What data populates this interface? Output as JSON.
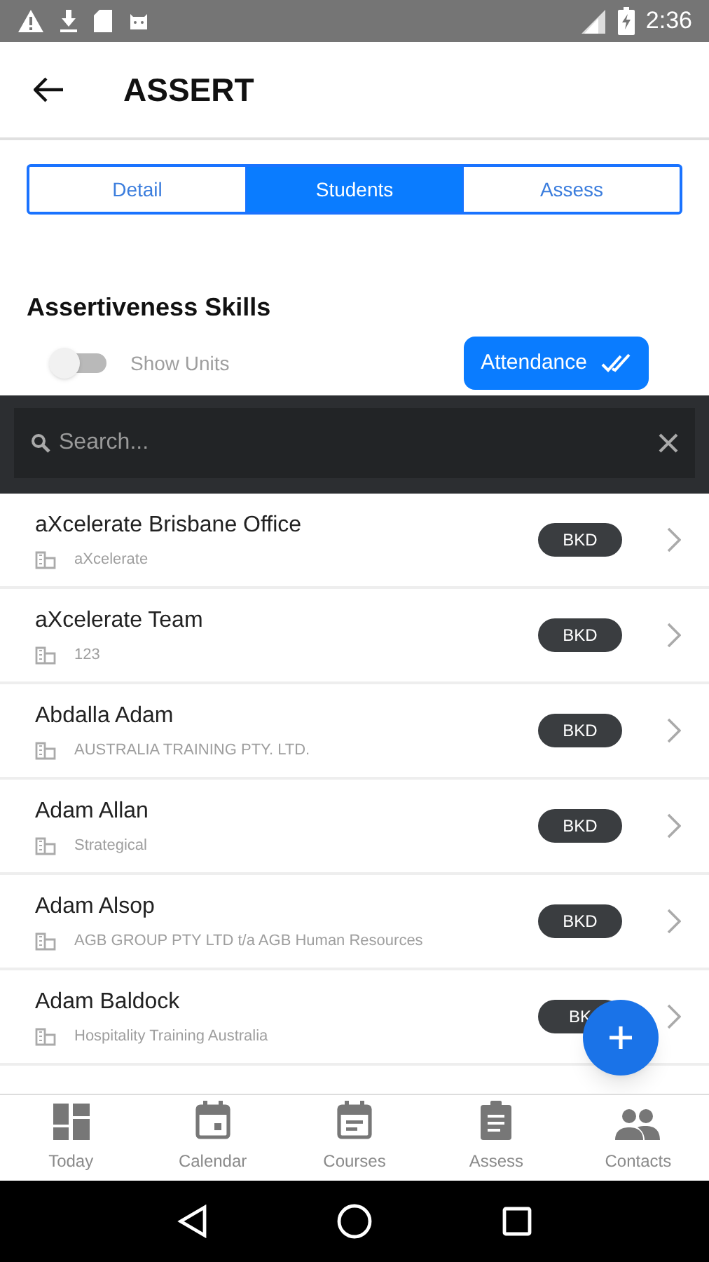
{
  "status_bar": {
    "time": "2:36"
  },
  "app_bar": {
    "title": "ASSERT"
  },
  "tabs": [
    {
      "label": "Detail",
      "selected": false
    },
    {
      "label": "Students",
      "selected": true
    },
    {
      "label": "Assess",
      "selected": false
    }
  ],
  "course_title": "Assertiveness Skills",
  "show_units": {
    "label": "Show Units",
    "on": false
  },
  "attendance_button": "Attendance",
  "search": {
    "placeholder": "Search..."
  },
  "students": [
    {
      "name": "aXcelerate Brisbane Office",
      "organisation": "aXcelerate",
      "badge": "BKD"
    },
    {
      "name": "aXcelerate Team",
      "organisation": "123",
      "badge": "BKD"
    },
    {
      "name": "Abdalla Adam",
      "organisation": "AUSTRALIA TRAINING PTY. LTD.",
      "badge": "BKD"
    },
    {
      "name": "Adam Allan",
      "organisation": "Strategical",
      "badge": "BKD"
    },
    {
      "name": "Adam Alsop",
      "organisation": "AGB GROUP PTY LTD t/a AGB Human Resources",
      "badge": "BKD"
    },
    {
      "name": "Adam Baldock",
      "organisation": "Hospitality Training Australia",
      "badge": "BK"
    }
  ],
  "bottom_nav": [
    {
      "label": "Today",
      "kind": "today"
    },
    {
      "label": "Calendar",
      "kind": "calendar"
    },
    {
      "label": "Courses",
      "kind": "courses"
    },
    {
      "label": "Assess",
      "kind": "assess"
    },
    {
      "label": "Contacts",
      "kind": "contacts"
    }
  ]
}
